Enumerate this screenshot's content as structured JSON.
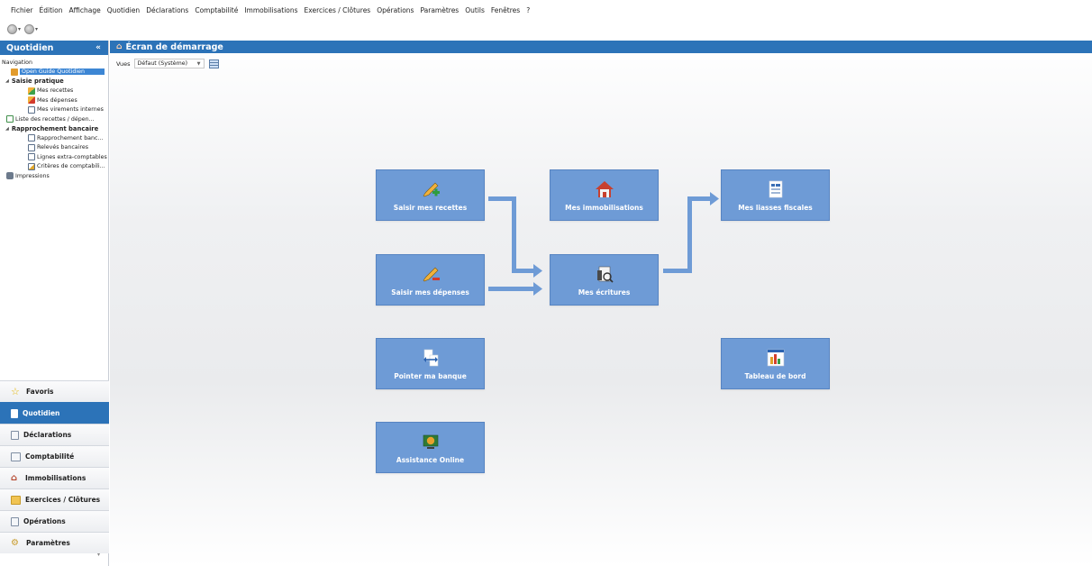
{
  "menu": [
    "Fichier",
    "Édition",
    "Affichage",
    "Quotidien",
    "Déclarations",
    "Comptabilité",
    "Immobilisations",
    "Exercices / Clôtures",
    "Opérations",
    "Paramètres",
    "Outils",
    "Fenêtres",
    "?"
  ],
  "sidebar": {
    "title": "Quotidien",
    "collapse_glyph": "«",
    "tree": {
      "navigation_label": "Navigation",
      "open_guide": "Open Guide Quotidien",
      "saisie_pratique": "Saisie pratique",
      "mes_recettes": "Mes recettes",
      "mes_depenses": "Mes dépenses",
      "mes_virements": "Mes virements internes",
      "liste_recettes": "Liste des recettes / dépen...",
      "rapprochement": "Rapprochement bancaire",
      "rapprochement_banc": "Rapprochement banc...",
      "releves": "Relevés bancaires",
      "lignes_extra": "Lignes extra-comptables",
      "criteres": "Critères de comptabili...",
      "impressions": "Impressions"
    },
    "modules": [
      {
        "label": "Favoris",
        "icon": "star-icon",
        "active": false
      },
      {
        "label": "Quotidien",
        "icon": "quotidien-icon",
        "active": true
      },
      {
        "label": "Déclarations",
        "icon": "document-icon",
        "active": false
      },
      {
        "label": "Comptabilité",
        "icon": "book-icon",
        "active": false
      },
      {
        "label": "Immobilisations",
        "icon": "house-icon",
        "active": false
      },
      {
        "label": "Exercices / Clôtures",
        "icon": "folder-icon",
        "active": false
      },
      {
        "label": "Opérations",
        "icon": "page-icon",
        "active": false
      },
      {
        "label": "Paramètres",
        "icon": "gear-icon",
        "active": false
      }
    ]
  },
  "main": {
    "title": "Écran de démarrage",
    "views_label": "Vues",
    "views_value": "Défaut (Système)",
    "tiles": {
      "recettes": "Saisir mes recettes",
      "immobilisations": "Mes immobilisations",
      "liasses": "Mes liasses fiscales",
      "depenses": "Saisir mes dépenses",
      "ecritures": "Mes écritures",
      "banque": "Pointer ma banque",
      "tableau": "Tableau de bord",
      "assistance": "Assistance Online"
    }
  },
  "colors": {
    "accent": "#2c73b8",
    "tile": "#6e9bd6",
    "arrow": "#6e9bd6"
  }
}
